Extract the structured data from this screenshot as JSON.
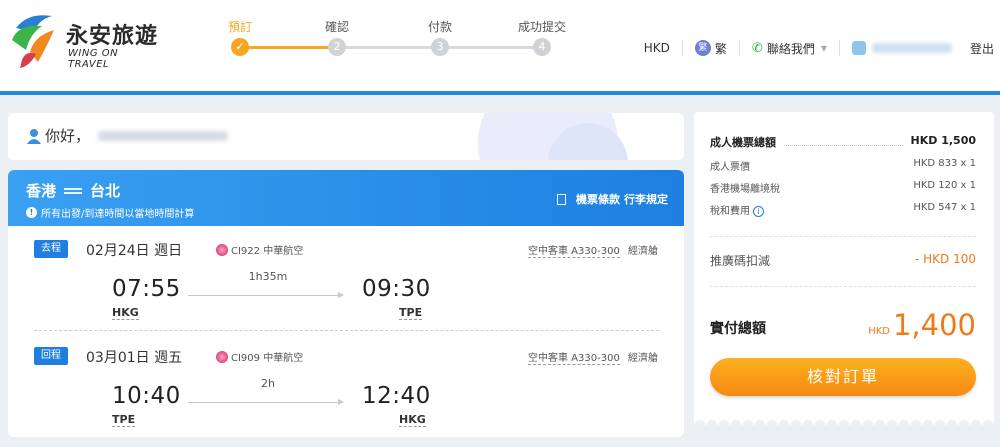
{
  "brand": {
    "name_cn": "永安旅遊",
    "name_en": "WING ON TRAVEL"
  },
  "steps": [
    {
      "label": "預訂",
      "num": "✓",
      "active": true
    },
    {
      "label": "確認",
      "num": "2"
    },
    {
      "label": "付款",
      "num": "3"
    },
    {
      "label": "成功提交",
      "num": "4"
    }
  ],
  "header": {
    "currency": "HKD",
    "lang_icon": "繁",
    "language": "繁",
    "contact": "聯絡我們",
    "logout": "登出"
  },
  "greeting": {
    "text": "你好，"
  },
  "flight": {
    "from": "香港",
    "to": "台北",
    "note": "所有出發/到達時間以當地時間計算",
    "rules_1": "機票條款",
    "rules_2": "行李規定",
    "legs": [
      {
        "tag": "去程",
        "date": "02月24日 週日",
        "airline": "CI922 中華航空",
        "aircraft": "空中客車 A330-300",
        "cabin": "經濟艙",
        "dep_time": "07:55",
        "dep_code": "HKG",
        "duration": "1h35m",
        "arr_time": "09:30",
        "arr_code": "TPE"
      },
      {
        "tag": "回程",
        "date": "03月01日 週五",
        "airline": "CI909 中華航空",
        "aircraft": "空中客車 A330-300",
        "cabin": "經濟艙",
        "dep_time": "10:40",
        "dep_code": "TPE",
        "duration": "2h",
        "arr_time": "12:40",
        "arr_code": "HKG"
      }
    ]
  },
  "price": {
    "adult_total_label": "成人機票總額",
    "adult_total_value": "HKD 1,500",
    "fare_label": "成人票價",
    "fare_value": "HKD 833 x 1",
    "tax_hk_label": "香港機場離境稅",
    "tax_hk_value": "HKD 120 x 1",
    "tax_other_label": "稅和費用",
    "tax_other_value": "HKD 547 x 1",
    "promo_label": "推廣碼扣減",
    "promo_value": "- HKD 100",
    "total_label": "實付總額",
    "total_currency": "HKD",
    "total_amount": "1,400",
    "confirm_button": "核對訂單"
  },
  "colors": {
    "accent": "#1e88e5",
    "orange": "#f5a623",
    "price": "#f07a1a"
  }
}
